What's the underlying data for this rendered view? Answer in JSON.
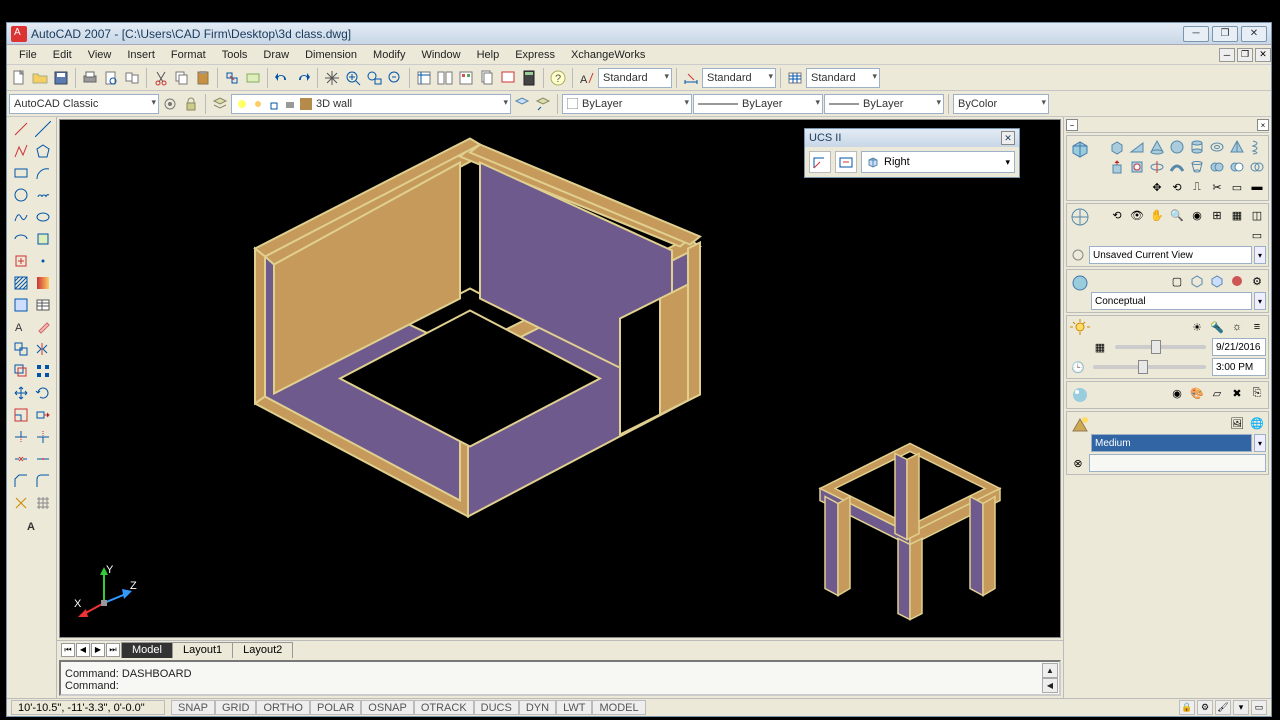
{
  "title": "AutoCAD 2007 - [C:\\Users\\CAD Firm\\Desktop\\3d class.dwg]",
  "menu": [
    "File",
    "Edit",
    "View",
    "Insert",
    "Format",
    "Tools",
    "Draw",
    "Dimension",
    "Modify",
    "Window",
    "Help",
    "Express",
    "XchangeWorks"
  ],
  "workspace": "AutoCAD Classic",
  "layer": "3D wall",
  "styles": {
    "text": "Standard",
    "dim": "Standard",
    "table": "Standard"
  },
  "props": {
    "color": "ByLayer",
    "ltype": "ByLayer",
    "lweight": "ByLayer",
    "plot": "ByColor"
  },
  "ucs": {
    "title": "UCS II",
    "value": "Right"
  },
  "tabs": [
    "Model",
    "Layout1",
    "Layout2"
  ],
  "active_tab": 0,
  "cmd": {
    "line1": "Command: DASHBOARD",
    "line2": "Command:"
  },
  "status": {
    "coords": "10'-10.5\", -11'-3.3\", 0'-0.0\"",
    "toggles": [
      "SNAP",
      "GRID",
      "ORTHO",
      "POLAR",
      "OSNAP",
      "OTRACK",
      "DUCS",
      "DYN",
      "LWT",
      "MODEL"
    ]
  },
  "dashboard": {
    "view": "Unsaved Current View",
    "visual": "Conceptual",
    "date": "9/21/2016",
    "time": "3:00 PM",
    "preset": "Medium"
  }
}
